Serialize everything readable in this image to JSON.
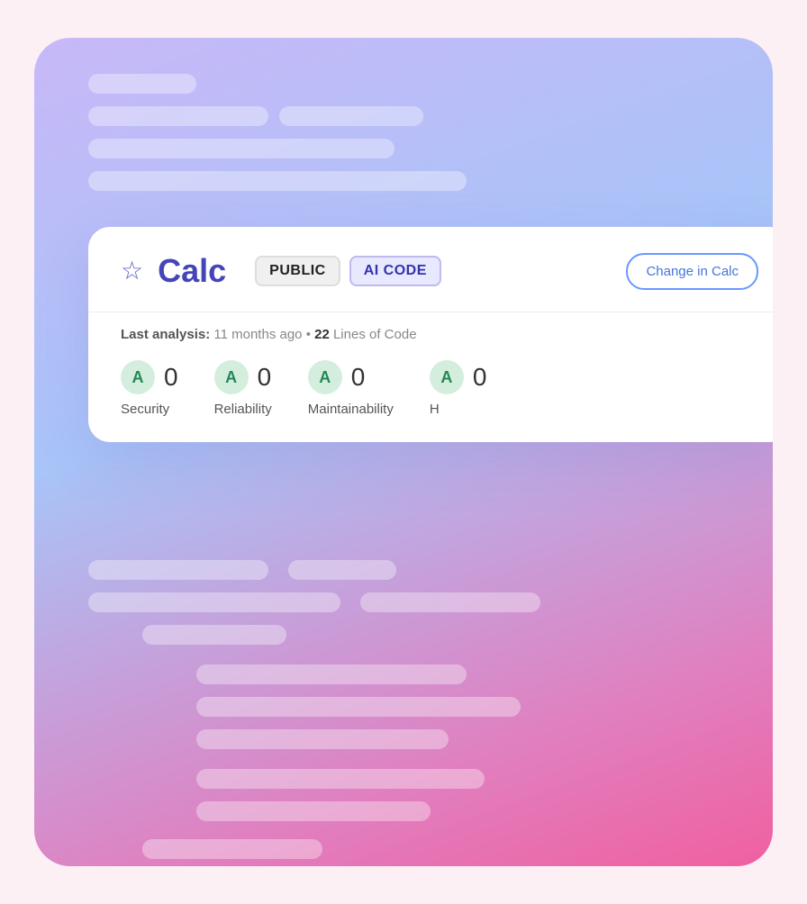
{
  "background": {
    "gradient_start": "#c8b8f8",
    "gradient_end": "#f060a0"
  },
  "card": {
    "star_symbol": "☆",
    "project_title": "Calc",
    "badge_public": "PUBLIC",
    "badge_ai_code": "AI CODE",
    "change_button": "Change in Calc"
  },
  "meta": {
    "last_analysis_label": "Last analysis:",
    "last_analysis_value": "11 months ago",
    "separator": "•",
    "lines_count": "22",
    "lines_label": "Lines of Code"
  },
  "metrics": [
    {
      "grade": "A",
      "score": "0",
      "label": "Security"
    },
    {
      "grade": "A",
      "score": "0",
      "label": "Reliability"
    },
    {
      "grade": "A",
      "score": "0",
      "label": "Maintainability"
    },
    {
      "grade": "A",
      "score": "0",
      "label": "H"
    }
  ],
  "bg_lines_top": [
    {
      "width": "35%"
    },
    {
      "width": "60%"
    },
    {
      "width": "80%"
    },
    {
      "width": "70%"
    }
  ],
  "bg_lines_bottom": [
    {
      "width": "45%",
      "offset": "0"
    },
    {
      "width": "30%",
      "offset": "0"
    },
    {
      "width": "70%",
      "offset": "0"
    },
    {
      "width": "80%",
      "offset": "0"
    },
    {
      "width": "60%",
      "offset": "0"
    },
    {
      "width": "50%",
      "offset": "15%"
    },
    {
      "width": "65%",
      "offset": "15%"
    },
    {
      "width": "55%",
      "offset": "15%"
    },
    {
      "width": "45%",
      "offset": "0"
    }
  ]
}
